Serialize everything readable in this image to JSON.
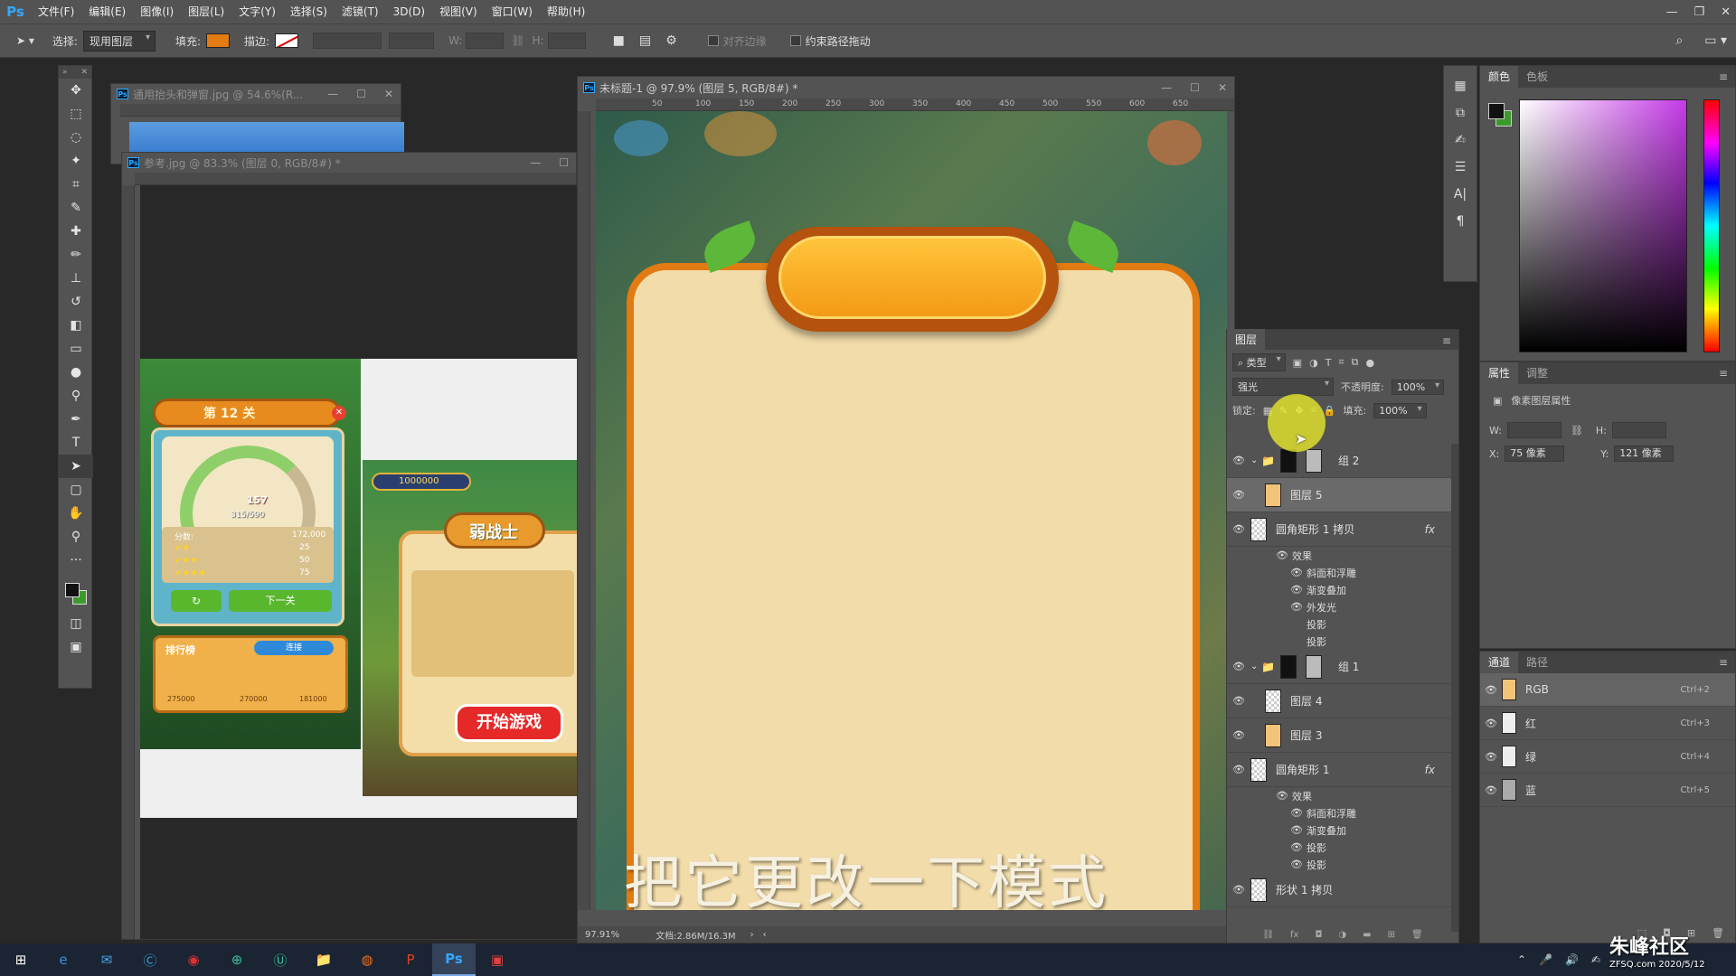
{
  "menu": {
    "logo": "Ps",
    "items": [
      "文件(F)",
      "编辑(E)",
      "图像(I)",
      "图层(L)",
      "文字(Y)",
      "选择(S)",
      "滤镜(T)",
      "3D(D)",
      "视图(V)",
      "窗口(W)",
      "帮助(H)"
    ]
  },
  "options": {
    "select_label": "选择:",
    "select_value": "现用图层",
    "fill_label": "填充:",
    "stroke_label": "描边:",
    "w_label": "W:",
    "h_label": "H:",
    "align_edges": "对齐边缘",
    "constrain_path": "约束路径拖动",
    "fill_color": "#e27b12"
  },
  "docs": {
    "doc1_title": "通用抬头和弹窗.jpg @ 54.6%(R...",
    "doc2_title": "参考.jpg @ 83.3% (图层 0, RGB/8#) *",
    "doc3_title": "未标题-1 @ 97.9% (图层 5, RGB/8#) *",
    "doc3_zoom": "97.91%",
    "doc3_status": "文档:2.86M/16.3M"
  },
  "reference": {
    "level_title": "第 12 关",
    "gauge_value": "157",
    "gauge_fraction": "315/590",
    "score_label": "分数:",
    "score_value": "172,000",
    "star_rows": [
      "25",
      "50",
      "75"
    ],
    "next_button": "下一关",
    "rank_title": "排行榜",
    "connect_label": "连接",
    "rank_scores": [
      "275000",
      "270000",
      "181000"
    ],
    "coin_value": "1000000",
    "popup_title": "弱战士",
    "start_button": "开始游戏"
  },
  "color_panel": {
    "tabs": [
      "颜色",
      "色板"
    ]
  },
  "properties": {
    "tabs": [
      "属性",
      "调整"
    ],
    "kind": "像素图层属性",
    "w_label": "W:",
    "h_label": "H:",
    "x_label": "X:",
    "x_value": "75 像素",
    "y_label": "Y:",
    "y_value": "121 像素"
  },
  "channels": {
    "tabs": [
      "通道",
      "路径"
    ],
    "rows": [
      {
        "name": "RGB",
        "shortcut": "Ctrl+2"
      },
      {
        "name": "红",
        "shortcut": "Ctrl+3"
      },
      {
        "name": "绿",
        "shortcut": "Ctrl+4"
      },
      {
        "name": "蓝",
        "shortcut": "Ctrl+5"
      }
    ]
  },
  "layers": {
    "title": "图层",
    "filter_kind": "类型",
    "blend_mode": "强光",
    "opacity_label": "不透明度:",
    "opacity_value": "100%",
    "lock_label": "锁定:",
    "fill_label": "填充:",
    "fill_value": "100%",
    "fx_label": "fx",
    "rows": {
      "group2": "组 2",
      "layer5": "图层 5",
      "rect_copy": "圆角矩形 1 拷贝",
      "effects1": "效果",
      "e1_bevel": "斜面和浮雕",
      "e1_grad": "渐变叠加",
      "e1_outer": "外发光",
      "e1_shadow1": "投影",
      "e1_shadow2": "投影",
      "group1": "组 1",
      "layer4": "图层 4",
      "layer3": "图层 3",
      "rect1": "圆角矩形 1",
      "effects2": "效果",
      "e2_bevel": "斜面和浮雕",
      "e2_grad": "渐变叠加",
      "e2_shadow1": "投影",
      "e2_shadow2": "投影",
      "shape_copy": "形状 1 拷贝"
    }
  },
  "subtitle": "把它更改一下模式",
  "watermark": {
    "name": "朱峰社区",
    "url": "ZFSQ.com",
    "date": "2020/5/12"
  }
}
